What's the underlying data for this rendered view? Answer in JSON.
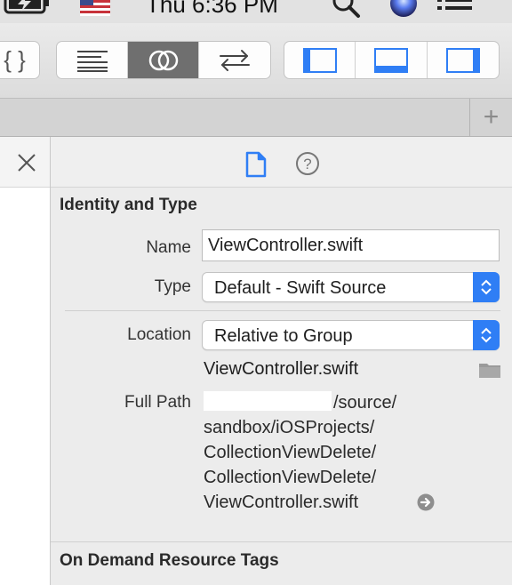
{
  "menubar": {
    "clock": "Thu 6:36 PM",
    "icons": [
      "battery-charging-icon",
      "us-flag-icon",
      "search-icon",
      "siri-icon",
      "menu-list-icon"
    ]
  },
  "toolbar": {
    "braces_label": "{ }",
    "editor_buttons": [
      "standard-editor-icon",
      "assistant-editor-icon",
      "version-editor-icon"
    ],
    "active_editor": "assistant-editor-icon",
    "panel_buttons": [
      "navigator-panel-icon",
      "debug-panel-icon",
      "utilities-panel-icon"
    ]
  },
  "tabbar": {
    "add_label": "+"
  },
  "inspector": {
    "tabs": [
      "file-inspector-icon",
      "quick-help-icon"
    ],
    "identity": {
      "header": "Identity and Type",
      "name_label": "Name",
      "name_value": "ViewController.swift",
      "type_label": "Type",
      "type_value": "Default - Swift Source",
      "location_label": "Location",
      "location_value": "Relative to Group",
      "location_filename": "ViewController.swift",
      "fullpath_label": "Full Path",
      "fullpath_lines": [
        "/source/",
        "sandbox/iOSProjects/",
        "CollectionViewDelete/",
        "CollectionViewDelete/",
        "ViewController.swift"
      ]
    },
    "ondemand": {
      "header": "On Demand Resource Tags"
    }
  },
  "colors": {
    "accent": "#2f7ef5",
    "active_segment": "#6f6f6f",
    "panel_background": "#ececec"
  }
}
